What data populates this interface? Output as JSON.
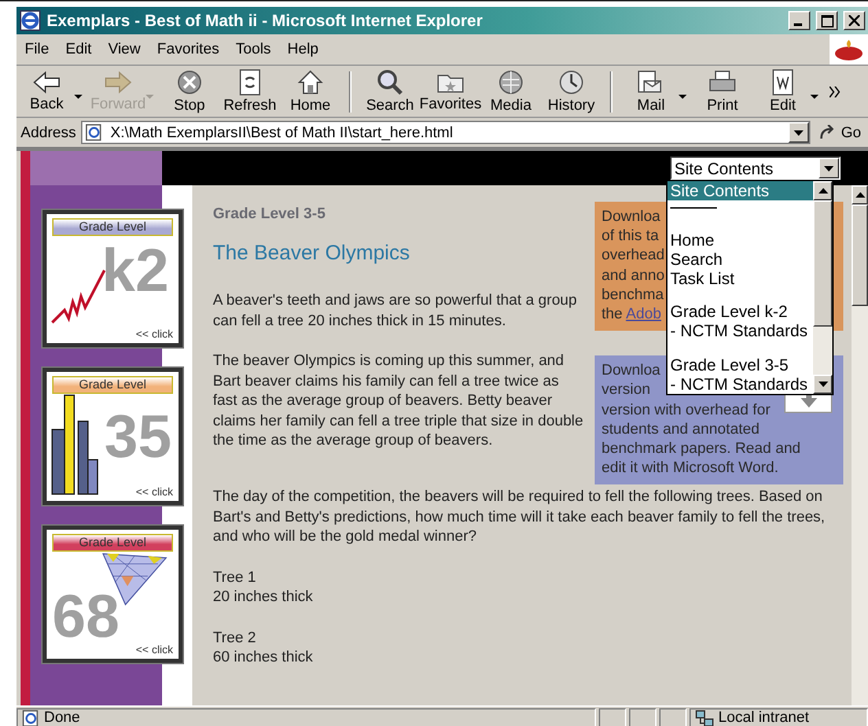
{
  "window": {
    "title": "Exemplars - Best of Math ii - Microsoft Internet Explorer"
  },
  "menu": [
    "File",
    "Edit",
    "View",
    "Favorites",
    "Tools",
    "Help"
  ],
  "toolbar": [
    {
      "label": "Back",
      "disabled": false,
      "dropdown": true
    },
    {
      "label": "Forward",
      "disabled": true,
      "dropdown": true
    },
    {
      "label": "Stop",
      "disabled": false,
      "dropdown": false
    },
    {
      "label": "Refresh",
      "disabled": false,
      "dropdown": false
    },
    {
      "label": "Home",
      "disabled": false,
      "dropdown": false,
      "separator_after": true
    },
    {
      "label": "Search",
      "disabled": false,
      "dropdown": false
    },
    {
      "label": "Favorites",
      "disabled": false,
      "dropdown": false
    },
    {
      "label": "Media",
      "disabled": false,
      "dropdown": false
    },
    {
      "label": "History",
      "disabled": false,
      "dropdown": false,
      "separator_after": true
    },
    {
      "label": "Mail",
      "disabled": false,
      "dropdown": true
    },
    {
      "label": "Print",
      "disabled": false,
      "dropdown": false
    },
    {
      "label": "Edit",
      "disabled": false,
      "dropdown": true
    }
  ],
  "address": {
    "label": "Address",
    "value": "X:\\Math ExemplarsII\\Best of Math II\\start_here.html",
    "go": "Go"
  },
  "page": {
    "site_contents": {
      "value": "Site Contents",
      "options": [
        {
          "kind": "item",
          "label": "Site Contents",
          "selected": true
        },
        {
          "kind": "rule",
          "selected": false
        },
        {
          "kind": "blank",
          "selected": false
        },
        {
          "kind": "item",
          "label": "Home",
          "selected": false
        },
        {
          "kind": "item",
          "label": "Search",
          "selected": false
        },
        {
          "kind": "item",
          "label": "Task List",
          "selected": false
        },
        {
          "kind": "blank",
          "selected": false
        },
        {
          "kind": "item",
          "label": "Grade Level k-2",
          "selected": false
        },
        {
          "kind": "item",
          "label": "- NCTM Standards",
          "selected": false
        },
        {
          "kind": "blank",
          "selected": false
        },
        {
          "kind": "item",
          "label": "Grade Level 3-5",
          "selected": false
        },
        {
          "kind": "item",
          "label": "- NCTM Standards",
          "selected": false
        }
      ]
    },
    "cards": [
      {
        "label": "Grade Level",
        "digits": "k2",
        "link": "<< click",
        "color": "#a9a9d2"
      },
      {
        "label": "Grade Level",
        "digits": "35",
        "link": "<< click",
        "color": "#f2b27a"
      },
      {
        "label": "Grade Level",
        "digits": "68",
        "link": "<< click",
        "color": "#d2405e"
      }
    ],
    "grade": "Grade Level 3-5",
    "title": "The Beaver Olympics",
    "downloads": [
      {
        "color": "#d9955c",
        "lines": [
          "Downloa",
          "of this ta",
          "overhead",
          "and anno",
          "benchma"
        ],
        "link_prefix": "the ",
        "link": "Adob",
        "button": false
      },
      {
        "color": "#8f95c8",
        "lines": [
          "Downloa",
          "version",
          "version with overhead for",
          "students and annotated",
          "benchmark papers. Read and",
          "edit it with Microsoft Word."
        ],
        "button": true
      }
    ],
    "paragraphs": [
      "A beaver's teeth and jaws are so powerful that a group can fell a tree 20 inches thick in 15 minutes.",
      "The beaver Olympics is coming up this summer, and Bart beaver claims his family can fell a tree twice as fast as the average group of beavers. Betty beaver claims her family can fell a tree triple that size in double the time as the average group of beavers.",
      "The day of the competition, the beavers will be required to fell the following trees. Based on Bart's and Betty's predictions, how much time will it take each beaver family to fell the trees, and who will be the gold medal winner?"
    ],
    "trees": [
      {
        "name": "Tree 1",
        "size": "20 inches thick"
      },
      {
        "name": "Tree 2",
        "size": "60 inches thick"
      }
    ]
  },
  "status": {
    "text": "Done",
    "zone": "Local intranet"
  }
}
